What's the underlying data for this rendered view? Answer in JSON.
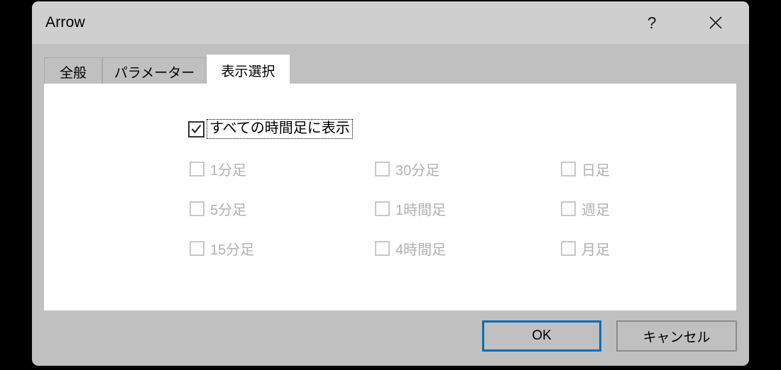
{
  "window": {
    "title": "Arrow",
    "help_icon": "question-mark-icon",
    "close_icon": "close-x-icon"
  },
  "tabs": [
    {
      "label": "全般",
      "active": false
    },
    {
      "label": "パラメーター",
      "active": false
    },
    {
      "label": "表示選択",
      "active": true
    }
  ],
  "master_checkbox": {
    "label": "すべての時間足に表示",
    "checked": true,
    "focused": true
  },
  "timeframes": {
    "enabled": false,
    "rows": [
      [
        {
          "label": "1分足",
          "checked": false
        },
        {
          "label": "30分足",
          "checked": false
        },
        {
          "label": "日足",
          "checked": false
        }
      ],
      [
        {
          "label": "5分足",
          "checked": false
        },
        {
          "label": "1時間足",
          "checked": false
        },
        {
          "label": "週足",
          "checked": false
        }
      ],
      [
        {
          "label": "15分足",
          "checked": false
        },
        {
          "label": "4時間足",
          "checked": false
        },
        {
          "label": "月足",
          "checked": false
        }
      ]
    ]
  },
  "footer": {
    "ok_label": "OK",
    "cancel_label": "キャンセル"
  },
  "colors": {
    "accent_focus": "#0a6cb8",
    "titlebar": "#cfcfcf",
    "dialog_body": "#c0c0c0",
    "panel": "#ffffff",
    "disabled_text": "#b1b1b1",
    "disabled_box": "#c8c8c8"
  }
}
